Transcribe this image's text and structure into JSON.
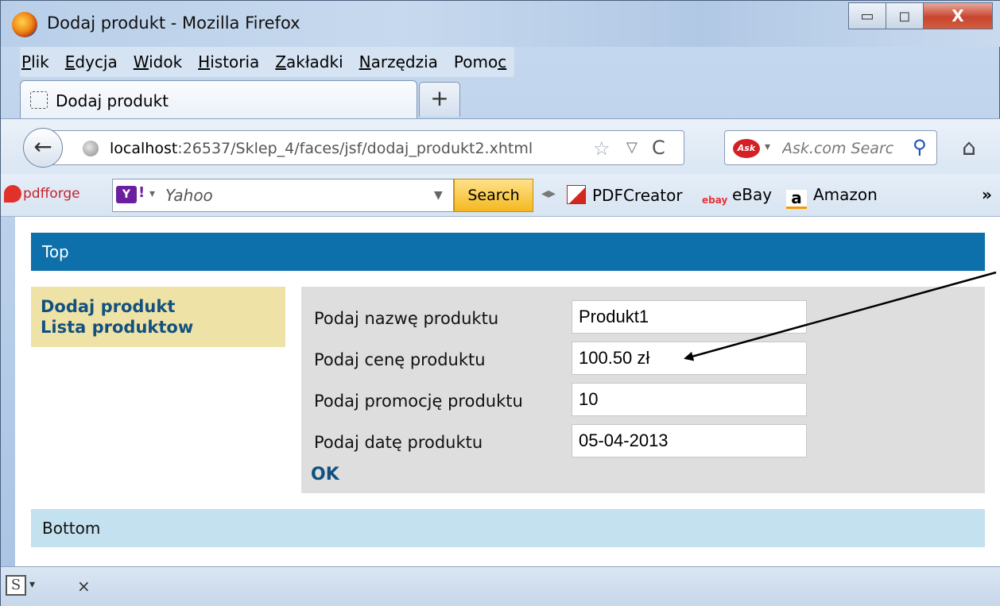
{
  "window": {
    "title": "Dodaj produkt - Mozilla Firefox",
    "controls": {
      "minimize": "▭",
      "maximize": "◻",
      "close": "X"
    }
  },
  "menubar": {
    "items": [
      {
        "underline": "P",
        "rest": "lik"
      },
      {
        "underline": "E",
        "rest": "dycja"
      },
      {
        "underline": "W",
        "rest": "idok"
      },
      {
        "underline": "H",
        "rest": "istoria"
      },
      {
        "underline": "Z",
        "rest": "akładki"
      },
      {
        "underline": "N",
        "rest": "arzędzia"
      },
      {
        "prefix": "Pomo",
        "underline": "c",
        "rest": ""
      }
    ]
  },
  "tabs": {
    "active_label": "Dodaj produkt",
    "new_tab": "+"
  },
  "navbar": {
    "back": "←",
    "url_host": "localhost",
    "url_rest": ":26537/Sklep_4/faces/jsf/dodaj_produkt2.xhtml",
    "star": "☆",
    "dropdown": "▽",
    "reload": "C",
    "search_engine_logo": "Ask",
    "search_placeholder": "Ask.com Searc",
    "search_go": "⚲",
    "home": "⌂"
  },
  "bookmarks": {
    "pdfforge": "pdfforge",
    "yahoo_logo": "Y",
    "yahoo_text": "Yahoo",
    "yahoo_search_btn": "Search",
    "items": [
      "PDFCreator",
      "eBay",
      "Amazon"
    ],
    "more": "»"
  },
  "page": {
    "top": "Top",
    "left_menu": [
      "Dodaj produkt",
      "Lista produktow"
    ],
    "form": {
      "name_label": "Podaj nazwę produktu",
      "name_value": "Produkt1",
      "price_label": "Podaj cenę produktu",
      "price_value": "100.50 zł",
      "promo_label": "Podaj promocję produktu",
      "promo_value": "10",
      "date_label": "Podaj datę produktu",
      "date_value": "05-04-2013",
      "ok": "OK"
    },
    "bottom": "Bottom"
  },
  "statusbar": {
    "s_icon": "S",
    "dropdown": "▾",
    "close": "×"
  },
  "colors": {
    "top_band": "#0e70ab",
    "left_menu_bg": "#efe2a6",
    "link": "#12517f",
    "form_bg": "#dedede",
    "bottom_band": "#c3e1ee"
  }
}
